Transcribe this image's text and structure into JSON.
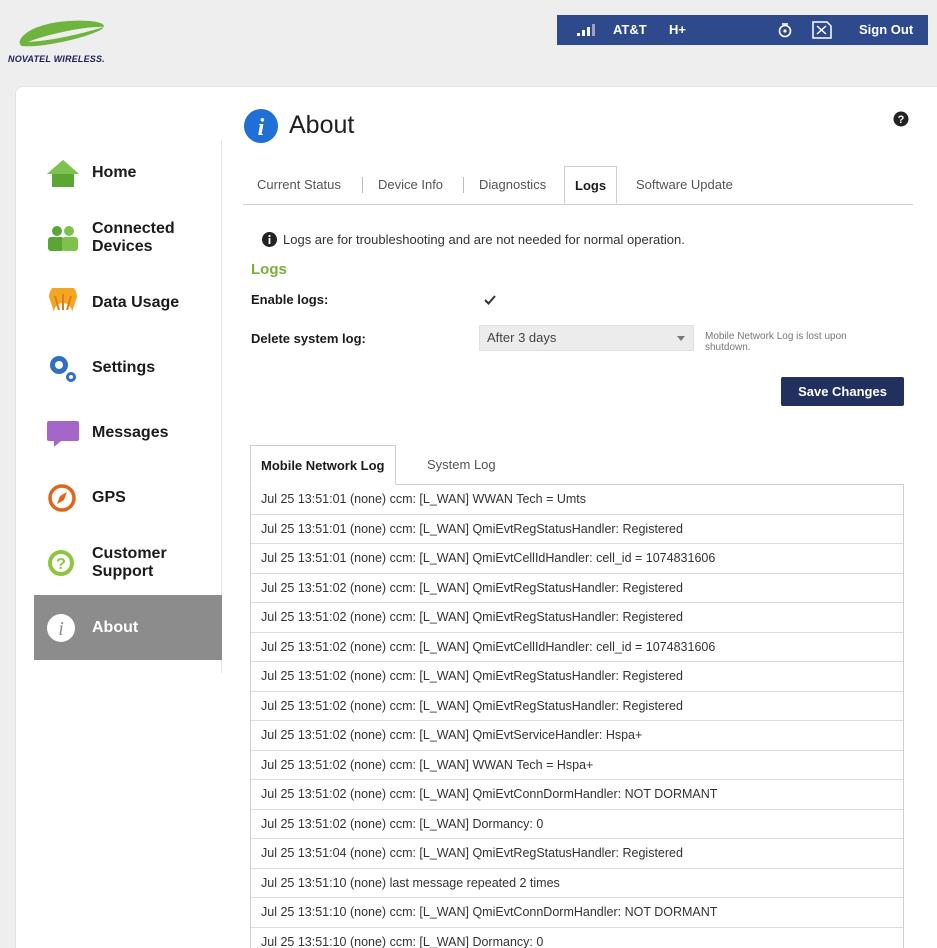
{
  "brand": {
    "name": "NOVATEL WIRELESS."
  },
  "statusbar": {
    "signal_icon": "signal-bars-icon",
    "carrier": "AT&T",
    "network": "H+",
    "wifi_icon": "hotspot-icon",
    "sim_icon": "sim-icon",
    "signout": "Sign Out"
  },
  "sidebar": {
    "items": [
      {
        "label": "Home",
        "icon": "home-icon"
      },
      {
        "label": "Connected\nDevices",
        "icon": "connected-devices-icon"
      },
      {
        "label": "Data Usage",
        "icon": "data-usage-icon"
      },
      {
        "label": "Settings",
        "icon": "settings-icon"
      },
      {
        "label": "Messages",
        "icon": "messages-icon"
      },
      {
        "label": "GPS",
        "icon": "gps-icon"
      },
      {
        "label": "Customer\nSupport",
        "icon": "customer-support-icon"
      },
      {
        "label": "About",
        "icon": "about-icon",
        "active": true
      }
    ]
  },
  "page": {
    "title": "About",
    "help_icon": "help-icon"
  },
  "tabs": [
    {
      "label": "Current Status"
    },
    {
      "label": "Device Info"
    },
    {
      "label": "Diagnostics"
    },
    {
      "label": "Logs",
      "active": true
    },
    {
      "label": "Software Update"
    }
  ],
  "logs": {
    "info": "Logs are for troubleshooting and are not needed for normal operation.",
    "section_title": "Logs",
    "enable_label": "Enable logs:",
    "enable_checked": true,
    "delete_label": "Delete system log:",
    "delete_value": "After 3 days",
    "delete_note": "Mobile Network Log is lost upon shutdown.",
    "save_label": "Save Changes"
  },
  "log_tabs": [
    {
      "label": "Mobile Network Log",
      "active": true
    },
    {
      "label": "System Log"
    }
  ],
  "log_entries": [
    "Jul 25 13:51:01 (none) ccm: [L_WAN] WWAN Tech = Umts",
    "Jul 25 13:51:01 (none) ccm: [L_WAN] QmiEvtRegStatusHandler: Registered",
    "Jul 25 13:51:01 (none) ccm: [L_WAN] QmiEvtCellIdHandler: cell_id = 1074831606",
    "Jul 25 13:51:02 (none) ccm: [L_WAN] QmiEvtRegStatusHandler: Registered",
    "Jul 25 13:51:02 (none) ccm: [L_WAN] QmiEvtRegStatusHandler: Registered",
    "Jul 25 13:51:02 (none) ccm: [L_WAN] QmiEvtCellIdHandler: cell_id = 1074831606",
    "Jul 25 13:51:02 (none) ccm: [L_WAN] QmiEvtRegStatusHandler: Registered",
    "Jul 25 13:51:02 (none) ccm: [L_WAN] QmiEvtRegStatusHandler: Registered",
    "Jul 25 13:51:02 (none) ccm: [L_WAN] QmiEvtServiceHandler: Hspa+",
    "Jul 25 13:51:02 (none) ccm: [L_WAN] WWAN Tech = Hspa+",
    "Jul 25 13:51:02 (none) ccm: [L_WAN] QmiEvtConnDormHandler: NOT DORMANT",
    "Jul 25 13:51:02 (none) ccm: [L_WAN] Dormancy: 0",
    "Jul 25 13:51:04 (none) ccm: [L_WAN] QmiEvtRegStatusHandler: Registered",
    "Jul 25 13:51:10 (none) last message repeated 2 times",
    "Jul 25 13:51:10 (none) ccm: [L_WAN] QmiEvtConnDormHandler: NOT DORMANT",
    "Jul 25 13:51:10 (none) ccm: [L_WAN] Dormancy: 0"
  ],
  "colors": {
    "statusbar_bg": "#2e4a8c",
    "accent_green": "#7ab03a",
    "button_bg": "#22305f",
    "active_nav_bg": "#8c8c8c",
    "about_icon_blue": "#1f6fd6"
  }
}
